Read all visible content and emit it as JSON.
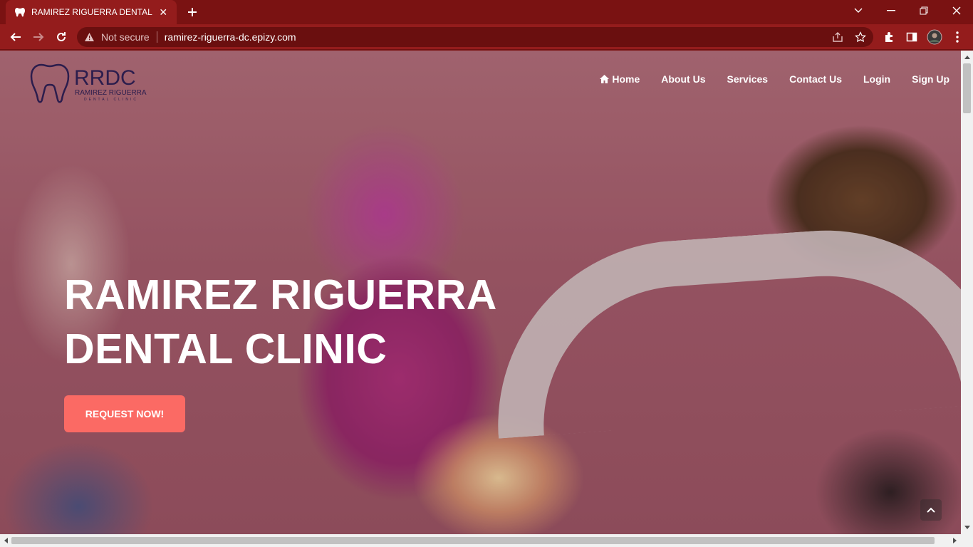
{
  "browser": {
    "tab_title": "RAMIREZ RIGUERRA DENTAL CLINIC",
    "security_label": "Not secure",
    "url": "ramirez-riguerra-dc.epizy.com",
    "theme_color": "#941c1c"
  },
  "site": {
    "logo": {
      "abbr": "RRDC",
      "line1": "RAMIREZ RIGUERRA",
      "line2": "DENTAL CLINIC"
    },
    "nav": [
      {
        "label": "Home",
        "icon": "home-icon"
      },
      {
        "label": "About Us"
      },
      {
        "label": "Services"
      },
      {
        "label": "Contact Us"
      },
      {
        "label": "Login"
      },
      {
        "label": "Sign Up"
      }
    ],
    "hero": {
      "title_line1": "RAMIREZ RIGUERRA",
      "title_line2": "DENTAL CLINIC",
      "cta_label": "REQUEST NOW!",
      "cta_color": "#fb6a64"
    }
  }
}
